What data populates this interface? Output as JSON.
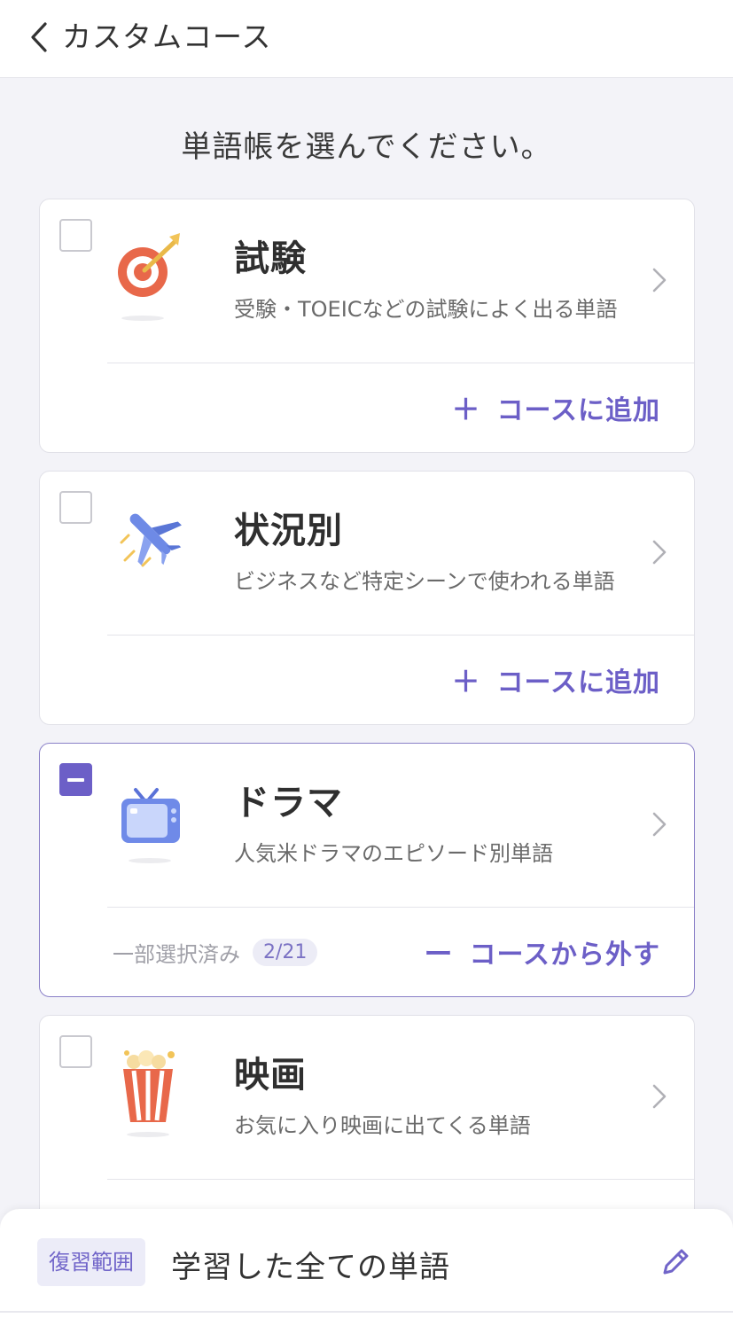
{
  "header": {
    "title": "カスタムコース"
  },
  "prompt": "単語帳を選んでください。",
  "cards": [
    {
      "title": "試験",
      "description": "受験・TOEICなどの試験によく出る単語",
      "icon": "target-icon",
      "action_symbol": "＋",
      "action_label": "コースに追加",
      "state": "unchecked"
    },
    {
      "title": "状況別",
      "description": "ビジネスなど特定シーンで使われる単語",
      "icon": "airplane-icon",
      "action_symbol": "＋",
      "action_label": "コースに追加",
      "state": "unchecked"
    },
    {
      "title": "ドラマ",
      "description": "人気米ドラマのエピソード別単語",
      "icon": "tv-icon",
      "action_symbol": "ー",
      "action_label": "コースから外す",
      "state": "partial",
      "partial_label": "一部選択済み",
      "partial_count": "2/21"
    },
    {
      "title": "映画",
      "description": "お気に入り映画に出てくる単語",
      "icon": "popcorn-icon",
      "state": "unchecked"
    }
  ],
  "bottom_bar": {
    "tag": "復習範囲",
    "value": "学習した全ての単語"
  },
  "colors": {
    "accent": "#6c5fc7",
    "background": "#f3f3f8"
  }
}
